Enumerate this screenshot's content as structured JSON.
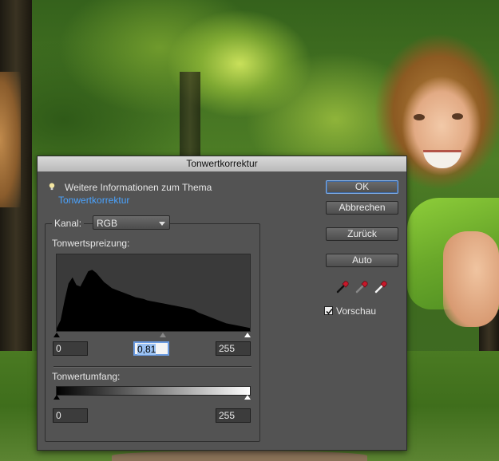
{
  "window": {
    "title": "Tonwertkorrektur"
  },
  "info": {
    "text": "Weitere Informationen zum Thema",
    "link": "Tonwertkorrektur"
  },
  "channel": {
    "label": "Kanal:",
    "value": "RGB"
  },
  "input_levels": {
    "label": "Tonwertspreizung:",
    "black": "0",
    "gamma": "0,81",
    "white": "255",
    "black_value": 0,
    "gamma_value": 0.81,
    "white_value": 255
  },
  "output_levels": {
    "label": "Tonwertumfang:",
    "black": "0",
    "white": "255",
    "black_value": 0,
    "white_value": 255
  },
  "histogram": [
    4,
    14,
    40,
    62,
    70,
    60,
    58,
    68,
    78,
    80,
    76,
    70,
    64,
    60,
    56,
    54,
    52,
    50,
    48,
    46,
    44,
    43,
    42,
    40,
    39,
    38,
    37,
    36,
    35,
    34,
    33,
    32,
    31,
    30,
    29,
    27,
    24,
    22,
    20,
    18,
    16,
    14,
    12,
    10,
    9,
    8,
    7,
    6,
    5,
    4
  ],
  "buttons": {
    "ok": "OK",
    "cancel": "Abbrechen",
    "reset": "Zurück",
    "auto": "Auto"
  },
  "droppers": [
    "black-eyedropper-icon",
    "gray-eyedropper-icon",
    "white-eyedropper-icon"
  ],
  "preview": {
    "label": "Vorschau",
    "checked": true
  },
  "colors": {
    "dialog_bg": "#535353",
    "link": "#4aa3ff",
    "dropper": "#c8182a"
  }
}
